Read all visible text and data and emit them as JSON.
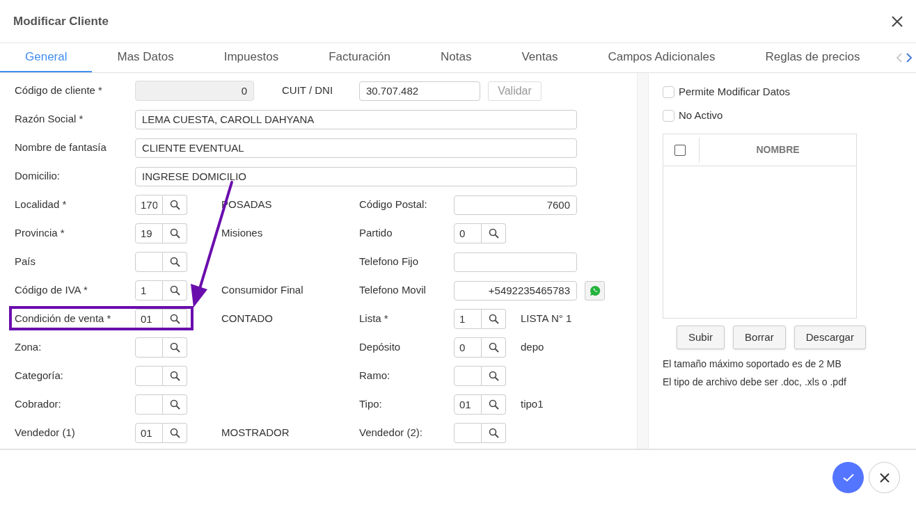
{
  "window": {
    "title": "Modificar Cliente"
  },
  "tabs": [
    {
      "label": "General",
      "selected": true
    },
    {
      "label": "Mas Datos",
      "selected": false
    },
    {
      "label": "Impuestos",
      "selected": false
    },
    {
      "label": "Facturación",
      "selected": false
    },
    {
      "label": "Notas",
      "selected": false
    },
    {
      "label": "Ventas",
      "selected": false
    },
    {
      "label": "Campos Adicionales",
      "selected": false
    },
    {
      "label": "Reglas de precios",
      "selected": false
    }
  ],
  "tab_scroll": {
    "left_disabled": true,
    "right_disabled": false
  },
  "form": {
    "header_row": {
      "label": "Código de cliente *",
      "value": "0",
      "disabled": true,
      "cuit_label": "CUIT / DNI",
      "cuit_value": "30.707.482",
      "button": {
        "label": "Validar",
        "disabled": true
      }
    },
    "rows": [
      {
        "label": "Razón Social *",
        "field": {
          "kind": "wide",
          "value": "LEMA CUESTA, CAROLL DAHYANA"
        },
        "highlighted": false
      },
      {
        "label": "Nombre de fantasía",
        "field": {
          "kind": "wide",
          "value": "CLIENTE EVENTUAL"
        },
        "highlighted": false
      },
      {
        "label": "Domicilio:",
        "field": {
          "kind": "wide",
          "value": "INGRESE DOMICILIO"
        },
        "highlighted": false
      },
      {
        "label": "Localidad *",
        "field": {
          "kind": "lookup",
          "value": "170"
        },
        "description": "POSADAS",
        "right": {
          "label": "Código Postal:",
          "field": {
            "kind": "number",
            "value": "7600"
          }
        },
        "highlighted": false
      },
      {
        "label": "Provincia *",
        "field": {
          "kind": "lookup",
          "value": "19"
        },
        "description": "Misiones",
        "right": {
          "label": "Partido",
          "field": {
            "kind": "lookup",
            "value": "0"
          }
        },
        "highlighted": false
      },
      {
        "label": "País",
        "field": {
          "kind": "lookup"
        },
        "right": {
          "label": "Telefono Fijo",
          "field": {
            "kind": "number"
          }
        },
        "highlighted": false
      },
      {
        "label": "Código de IVA *",
        "field": {
          "kind": "lookup",
          "value": "1"
        },
        "description": "Consumidor Final",
        "right": {
          "label": "Telefono Movil",
          "field": {
            "kind": "number",
            "value": "+5492235465783"
          },
          "whatsapp": true
        },
        "highlighted": false
      },
      {
        "label": "Condición de venta *",
        "field": {
          "kind": "lookup",
          "value": "01"
        },
        "description": "CONTADO",
        "right": {
          "label": "Lista *",
          "field": {
            "kind": "lookup",
            "value": "1"
          },
          "description": "LISTA N° 1"
        },
        "highlighted": true
      },
      {
        "label": "Zona:",
        "field": {
          "kind": "lookup"
        },
        "right": {
          "label": "Depósito",
          "field": {
            "kind": "lookup",
            "value": "0"
          },
          "description": "depo"
        },
        "highlighted": false
      },
      {
        "label": "Categoría:",
        "field": {
          "kind": "lookup"
        },
        "right": {
          "label": "Ramo:",
          "field": {
            "kind": "lookup"
          }
        },
        "highlighted": false
      },
      {
        "label": "Cobrador:",
        "field": {
          "kind": "lookup"
        },
        "right": {
          "label": "Tipo:",
          "field": {
            "kind": "lookup",
            "value": "01"
          },
          "description": "tipo1"
        },
        "highlighted": false
      },
      {
        "label": "Vendedor (1)",
        "field": {
          "kind": "lookup",
          "value": "01"
        },
        "description": "MOSTRADOR",
        "right": {
          "label": "Vendedor (2):",
          "field": {
            "kind": "lookup"
          }
        },
        "highlighted": false
      }
    ]
  },
  "side": {
    "checkboxes": [
      {
        "label": "Permite Modificar Datos",
        "checked": false
      },
      {
        "label": "No Activo",
        "checked": false
      }
    ],
    "files_table": {
      "select_all_checked": false,
      "columns": [
        "NOMBRE"
      ]
    },
    "buttons": [
      "Subir",
      "Borrar",
      "Descargar"
    ],
    "notes": [
      "El tamaño máximo soportado es de 2 MB",
      "El tipo de archivo debe ser .doc, .xls o .pdf"
    ]
  }
}
